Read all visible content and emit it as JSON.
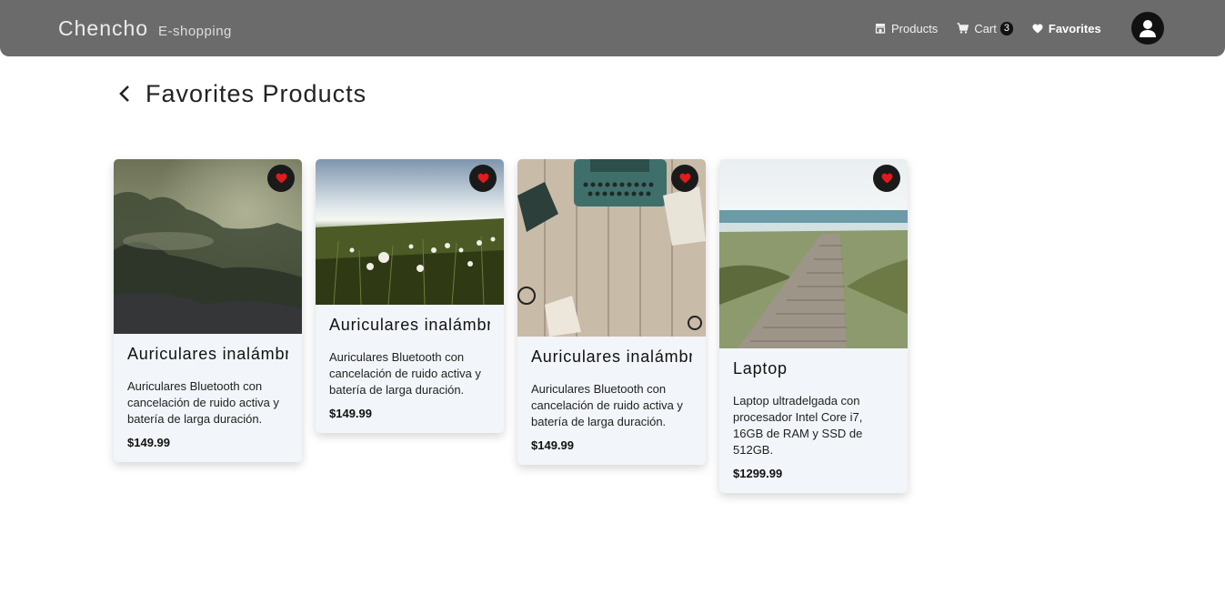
{
  "navbar": {
    "brand": "Chencho",
    "tagline": "E-shopping",
    "links": [
      {
        "label": "Products",
        "icon": "store-icon"
      },
      {
        "label": "Cart",
        "icon": "cart-icon",
        "badge": "3"
      },
      {
        "label": "Favorites",
        "icon": "heart-icon"
      }
    ],
    "avatar_icon": "user-icon"
  },
  "page": {
    "title": "Favorites Products"
  },
  "products": [
    {
      "title": "Auriculares inalámbricos",
      "description": "Auriculares Bluetooth con cancelación de ruido activa y batería de larga duración.",
      "price": "$149.99",
      "image": "misty-forest"
    },
    {
      "title": "Auriculares inalámbricos",
      "description": "Auriculares Bluetooth con cancelación de ruido activa y batería de larga duración.",
      "price": "$149.99",
      "image": "dandelion-field"
    },
    {
      "title": "Auriculares inalámbricos",
      "description": "Auriculares Bluetooth con cancelación de ruido activa y batería de larga duración.",
      "price": "$149.99",
      "image": "typewriter-on-wood"
    },
    {
      "title": "Laptop",
      "description": "Laptop ultradelgada con procesador Intel Core i7, 16GB de RAM y SSD de 512GB.",
      "price": "$1299.99",
      "image": "boardwalk-beach"
    }
  ],
  "colors": {
    "navbar_bg": "#6b6b6b",
    "card_bg": "#f2f5f9",
    "heart": "#e01b1b"
  }
}
